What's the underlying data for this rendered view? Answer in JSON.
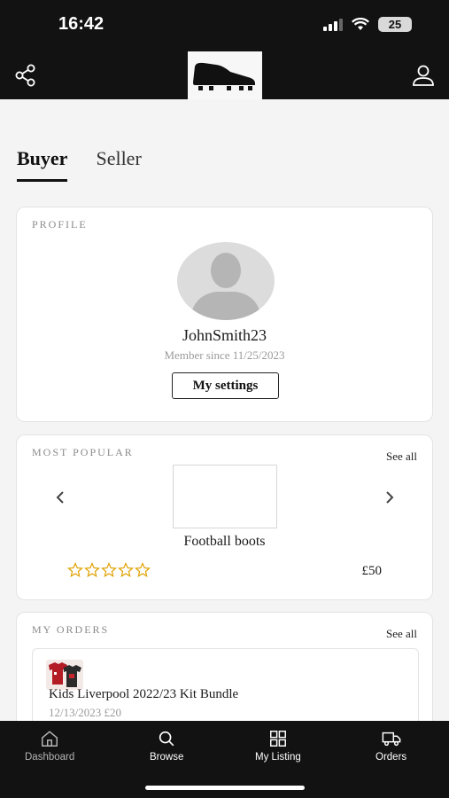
{
  "status_bar": {
    "time": "16:42",
    "battery": "25"
  },
  "header": {
    "logo_icon": "football-boot-icon",
    "share_icon": "share-icon",
    "account_icon": "user-icon"
  },
  "tabs": [
    {
      "label": "Buyer",
      "active": true
    },
    {
      "label": "Seller",
      "active": false
    }
  ],
  "profile": {
    "section_label": "PROFILE",
    "username": "JohnSmith23",
    "member_since": "Member since 11/25/2023",
    "settings_label": "My settings"
  },
  "most_popular": {
    "section_label": "MOST POPULAR",
    "see_all": "See all",
    "product_name": "Football boots",
    "rating_stars": 0,
    "rating_max": 5,
    "price": "£50"
  },
  "my_orders": {
    "section_label": "MY ORDERS",
    "see_all": "See all",
    "items": [
      {
        "title": "Kids Liverpool 2022/23 Kit Bundle",
        "meta": "12/13/2023 £20"
      }
    ]
  },
  "bottom_nav": [
    {
      "label": "Dashboard",
      "icon": "home-icon"
    },
    {
      "label": "Browse",
      "icon": "search-icon"
    },
    {
      "label": "My Listing",
      "icon": "grid-icon"
    },
    {
      "label": "Orders",
      "icon": "truck-icon"
    }
  ],
  "colors": {
    "header_bg": "#121212",
    "star": "#e0a100",
    "card_border": "#e3e3e3"
  }
}
